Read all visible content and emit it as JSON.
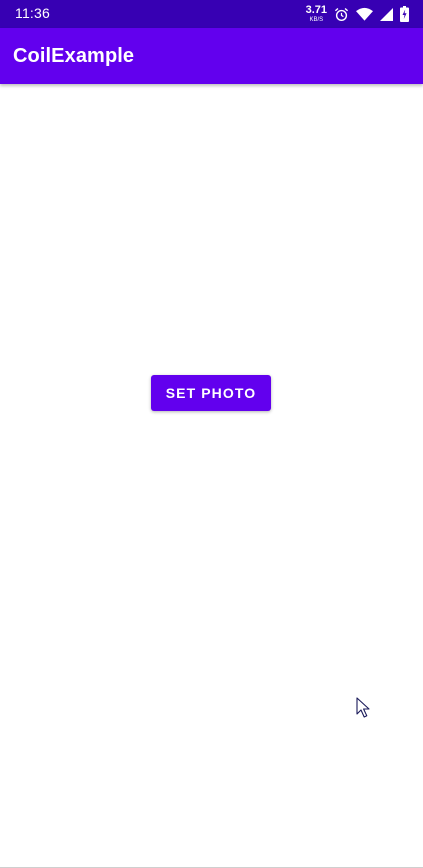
{
  "status_bar": {
    "time": "11:36",
    "network_speed_value": "3.71",
    "network_speed_unit": "KB/S",
    "icons": [
      "alarm-icon",
      "wifi-icon",
      "cellular-signal-icon",
      "battery-charging-icon"
    ]
  },
  "app_bar": {
    "title": "CoilExample"
  },
  "main": {
    "set_photo_label": "SET PHOTO"
  },
  "colors": {
    "status_bar": "#3700B3",
    "primary": "#6200EE",
    "background": "#FFFFFF",
    "on_primary": "#FFFFFF"
  }
}
